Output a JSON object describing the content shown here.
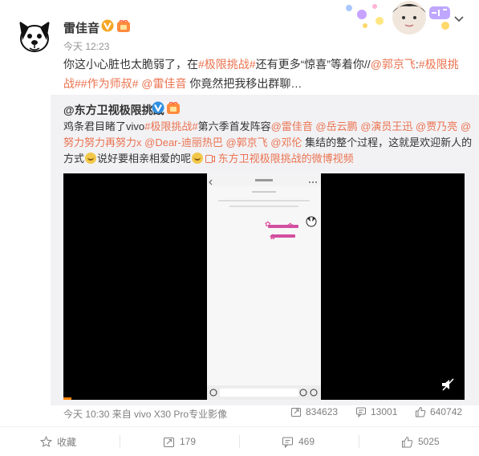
{
  "post": {
    "author": "雷佳音",
    "time": "今天 12:23",
    "text": {
      "p1": "你这小心脏也太脆弱了，在",
      "tag1": "#极限挑战#",
      "p2": "还有更多“惊喜”等着你//",
      "mention1": "@郭京飞",
      "p3": ":",
      "tag2": "#极限挑战#",
      "tag3": "#作为师叔#",
      "p4": " ",
      "mention2": "@雷佳音",
      "p5": " 你竟然把我移出群聊…"
    }
  },
  "repost": {
    "author": "@东方卫视极限挑战",
    "text": {
      "p1": "鸡条君目睹了vivo",
      "tag1": "#极限挑战#",
      "p2": "第六季首发阵容",
      "m1": "@雷佳音",
      "m2": " @岳云鹏",
      "m3": " @演员王迅",
      "m4": " @贾乃亮",
      "m5": " @努力努力再努力x",
      "m6": " @Dear-迪丽热巴",
      "m7": " @郭京飞",
      "m8": " @邓伦",
      "p3": " 集结的整个过程，这就是欢迎新人的方式",
      "p4": "说好要相亲相爱的呢",
      "video_link": " 东方卫视极限挑战的微博视频"
    },
    "source": "今天 10:30 来自 vivo X30 Pro专业影像",
    "stats": {
      "reposts": "834623",
      "comments": "13001",
      "likes": "640742"
    },
    "video_progress_fraction": 0.02
  },
  "actions": {
    "favorite": "收藏",
    "repost": "179",
    "comment": "469",
    "like": "5025"
  },
  "icons": [
    "dog-avatar",
    "vip-v-badge",
    "level-badge",
    "chevron-down-icon",
    "sticker-deco",
    "mute-icon",
    "repost-icon",
    "comment-icon",
    "like-icon",
    "star-icon",
    "video-link-icon"
  ],
  "colors": {
    "link": "#eb7350",
    "blue": "#0a6ec4",
    "repost_bg": "#f2f2f5",
    "progress": "#ff8200"
  }
}
